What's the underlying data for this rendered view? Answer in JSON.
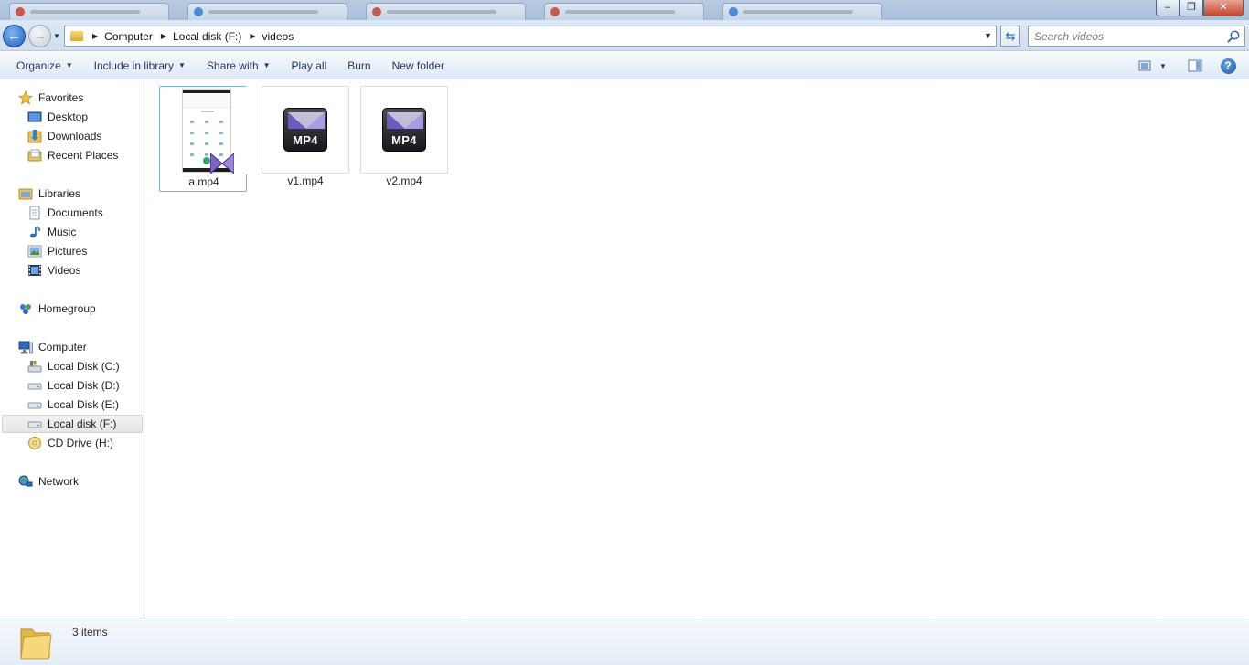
{
  "window": {
    "minimize_glyph": "–",
    "maximize_glyph": "❐",
    "close_glyph": "✕"
  },
  "address": {
    "breadcrumbs": [
      "Computer",
      "Local disk (F:)",
      "videos"
    ]
  },
  "search": {
    "placeholder": "Search videos"
  },
  "toolbar": {
    "organize": "Organize",
    "include_in_library": "Include in library",
    "share_with": "Share with",
    "play_all": "Play all",
    "burn": "Burn",
    "new_folder": "New folder"
  },
  "nav": {
    "favorites": "Favorites",
    "desktop": "Desktop",
    "downloads": "Downloads",
    "recent_places": "Recent Places",
    "libraries": "Libraries",
    "documents": "Documents",
    "music": "Music",
    "pictures": "Pictures",
    "videos": "Videos",
    "homegroup": "Homegroup",
    "computer": "Computer",
    "disk_c": "Local Disk (C:)",
    "disk_d": "Local Disk (D:)",
    "disk_e": "Local Disk (E:)",
    "disk_f": "Local disk (F:)",
    "cd_drive": "CD Drive (H:)",
    "network": "Network"
  },
  "files": [
    {
      "name": "a.mp4",
      "thumbnail": "phone-screenshot"
    },
    {
      "name": "v1.mp4",
      "badge": "MP4"
    },
    {
      "name": "v2.mp4",
      "badge": "MP4"
    }
  ],
  "status": {
    "item_count": "3 items"
  },
  "colors": {
    "accent": "#1f5fbf",
    "selection_border": "#84acdd",
    "toolbar_text": "#1e395b"
  }
}
